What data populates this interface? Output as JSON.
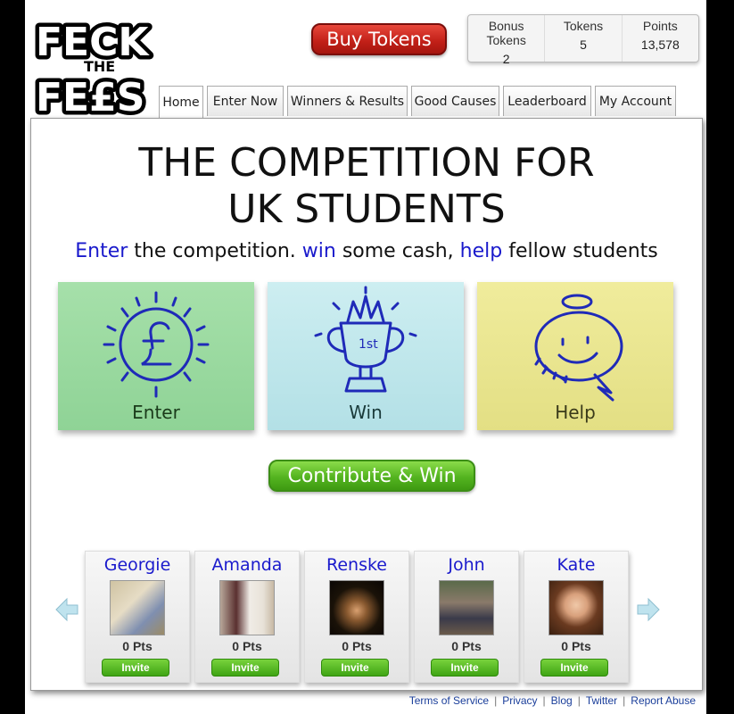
{
  "logo": {
    "line1": "FECK",
    "line2": "THE",
    "line3": "FE£S"
  },
  "buy_tokens_label": "Buy Tokens",
  "stats": [
    {
      "label": "Bonus Tokens",
      "value": "2"
    },
    {
      "label": "Tokens",
      "value": "5"
    },
    {
      "label": "Points",
      "value": "13,578"
    }
  ],
  "tabs": [
    "Home",
    "Enter Now",
    "Winners & Results",
    "Good Causes",
    "Leaderboard",
    "My Account"
  ],
  "headline": {
    "line1": "THE COMPETITION FOR",
    "line2": "UK STUDENTS"
  },
  "tagline": {
    "w1": "Enter",
    "t1": " the competition. ",
    "w2": "win",
    "t2": " some cash, ",
    "w3": "help",
    "t3": " fellow students"
  },
  "cards": [
    {
      "label": "Enter",
      "icon": "pound-coin-icon",
      "color": "#9fdca5"
    },
    {
      "label": "Win",
      "icon": "trophy-cup-icon",
      "color": "#bfe6ea"
    },
    {
      "label": "Help",
      "icon": "smiley-halo-icon",
      "color": "#ece98f"
    }
  ],
  "contribute_label": "Contribute & Win",
  "people": [
    {
      "name": "Georgie",
      "pts": "0 Pts",
      "invite": "Invite"
    },
    {
      "name": "Amanda",
      "pts": "0 Pts",
      "invite": "Invite"
    },
    {
      "name": "Renske",
      "pts": "0 Pts",
      "invite": "Invite"
    },
    {
      "name": "John",
      "pts": "0 Pts",
      "invite": "Invite"
    },
    {
      "name": "Kate",
      "pts": "0 Pts",
      "invite": "Invite"
    }
  ],
  "footer": [
    "Terms of Service",
    "Privacy",
    "Blog",
    "Twitter",
    "Report Abuse"
  ]
}
